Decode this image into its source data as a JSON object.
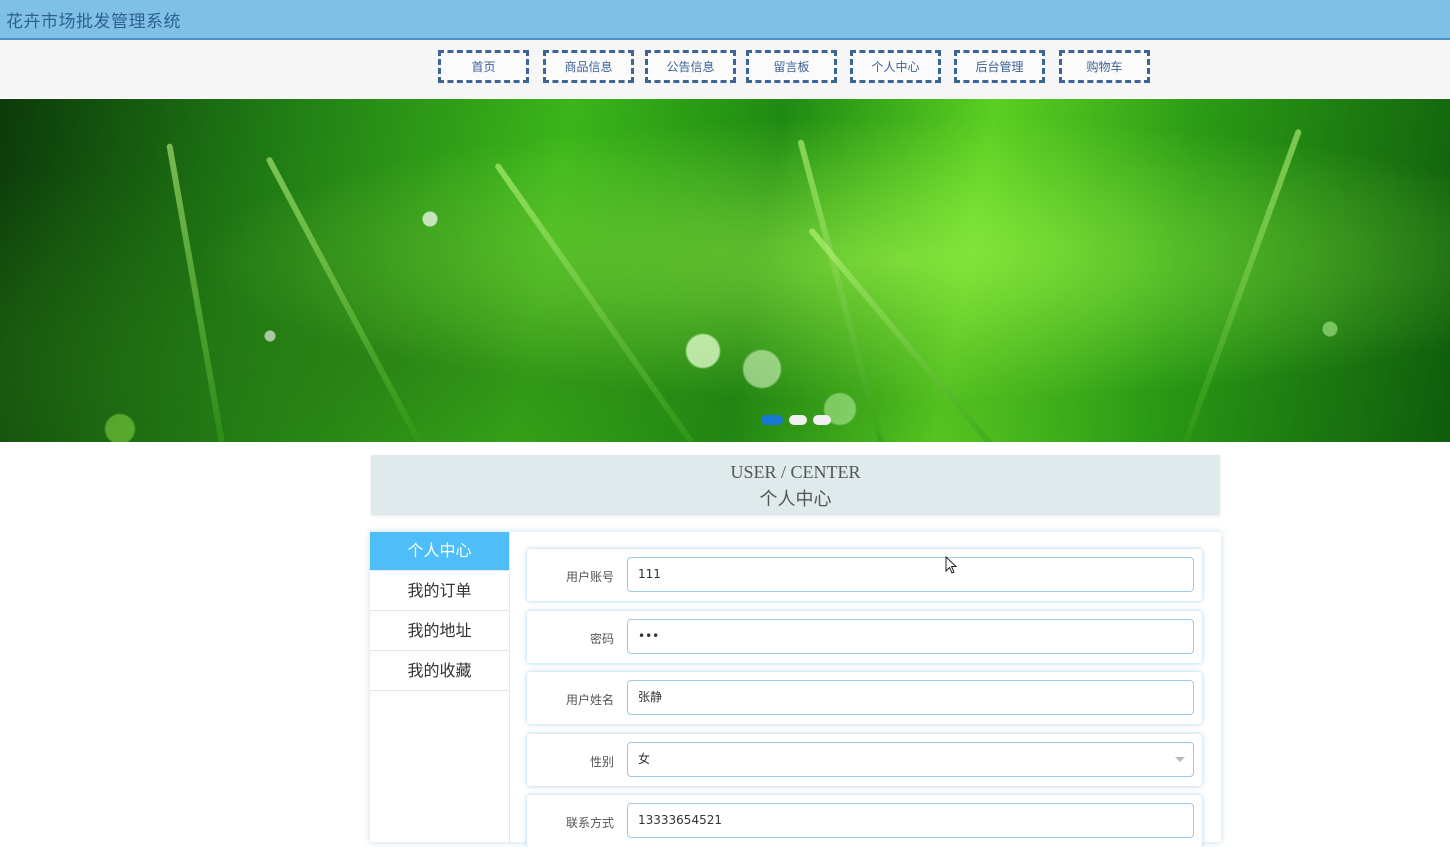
{
  "app": {
    "title": "花卉市场批发管理系统"
  },
  "nav": {
    "items": [
      {
        "label": "首页"
      },
      {
        "label": "商品信息"
      },
      {
        "label": "公告信息"
      },
      {
        "label": "留言板"
      },
      {
        "label": "个人中心"
      },
      {
        "label": "后台管理"
      },
      {
        "label": "购物车"
      }
    ]
  },
  "banner": {
    "slide_count": 3,
    "active_slide": 1
  },
  "section": {
    "title_en": "USER / CENTER",
    "title_zh": "个人中心"
  },
  "side_menu": {
    "items": [
      {
        "label": "个人中心",
        "active": true
      },
      {
        "label": "我的订单",
        "active": false
      },
      {
        "label": "我的地址",
        "active": false
      },
      {
        "label": "我的收藏",
        "active": false
      }
    ]
  },
  "form": {
    "account": {
      "label": "用户账号",
      "value": "111"
    },
    "password": {
      "label": "密码",
      "value": "•••"
    },
    "name": {
      "label": "用户姓名",
      "value": "张静"
    },
    "gender": {
      "label": "性别",
      "value": "女"
    },
    "phone": {
      "label": "联系方式",
      "value": "13333654521"
    }
  },
  "colors": {
    "topbar": "#7fc1e6",
    "nav_border": "#3d6399",
    "menu_active": "#4fbdf7",
    "input_border": "#9ccbe8",
    "dot_active": "#1976d2"
  }
}
